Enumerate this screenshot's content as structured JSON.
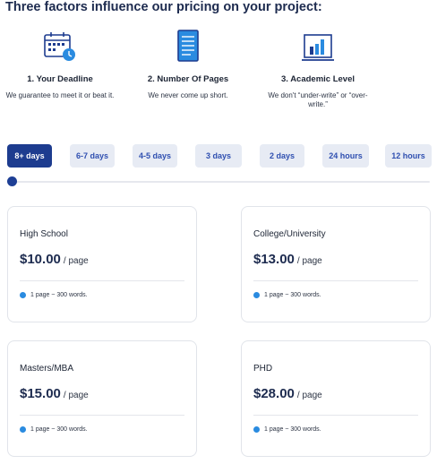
{
  "heading": "Three factors influence our pricing on your project:",
  "factors": [
    {
      "icon": "calendar-clock-icon",
      "name": "1. Your Deadline",
      "desc": "We guarantee to meet it or beat it."
    },
    {
      "icon": "document-icon",
      "name": "2. Number Of Pages",
      "desc": "We never come up short."
    },
    {
      "icon": "bar-chart-icon",
      "name": "3. Academic Level",
      "desc": "We don't “under-write” or “over-write.”"
    }
  ],
  "deadlines": {
    "selected": "8+ days",
    "options": [
      "8+ days",
      "6-7 days",
      "4-5 days",
      "3 days",
      "2 days",
      "24 hours",
      "12 hours"
    ]
  },
  "slider": {
    "position": 0
  },
  "cards": [
    {
      "level": "High School",
      "price": "$10.00",
      "unit": "/ page",
      "note": "1 page ~ 300 words."
    },
    {
      "level": "College/University",
      "price": "$13.00",
      "unit": "/ page",
      "note": "1 page ~ 300 words."
    },
    {
      "level": "Masters/MBA",
      "price": "$15.00",
      "unit": "/ page",
      "note": "1 page ~ 300 words."
    },
    {
      "level": "PHD",
      "price": "$28.00",
      "unit": "/ page",
      "note": "1 page ~ 300 words."
    }
  ],
  "colors": {
    "primary": "#1d3c8f",
    "chip_bg": "#e7ebf4",
    "chip_text": "#2f4fb0",
    "bullet": "#2a8be0",
    "heading": "#1d2b4f"
  }
}
